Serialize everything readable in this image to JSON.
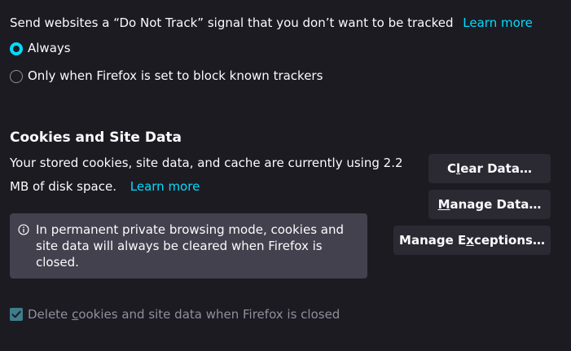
{
  "dnt": {
    "description": "Send websites a “Do Not Track” signal that you don’t want to be tracked",
    "learn_more": "Learn more",
    "options": [
      {
        "label": "Always",
        "selected": true
      },
      {
        "label": "Only when Firefox is set to block known trackers",
        "selected": false
      }
    ]
  },
  "cookies": {
    "heading": "Cookies and Site Data",
    "usage_line1": "Your stored cookies, site data, and cache are currently using 2.2",
    "usage_line2": "MB of disk space.",
    "learn_more": "Learn more",
    "buttons": {
      "clear_pre": "C",
      "clear_key": "l",
      "clear_post": "ear Data…",
      "manage_pre": "",
      "manage_key": "M",
      "manage_post": "anage Data…",
      "exceptions_pre": "Manage E",
      "exceptions_key": "x",
      "exceptions_post": "ceptions…"
    },
    "notice": "In permanent private browsing mode, cookies and site data will always be cleared when Firefox is closed.",
    "delete_checkbox": {
      "pre": "Delete ",
      "key": "c",
      "post": "ookies and site data when Firefox is closed",
      "checked": true,
      "disabled": true
    }
  },
  "colors": {
    "background": "#1c1b22",
    "accent": "#00ddff",
    "button_bg": "#2b2a33",
    "notice_bg": "#42414d"
  }
}
